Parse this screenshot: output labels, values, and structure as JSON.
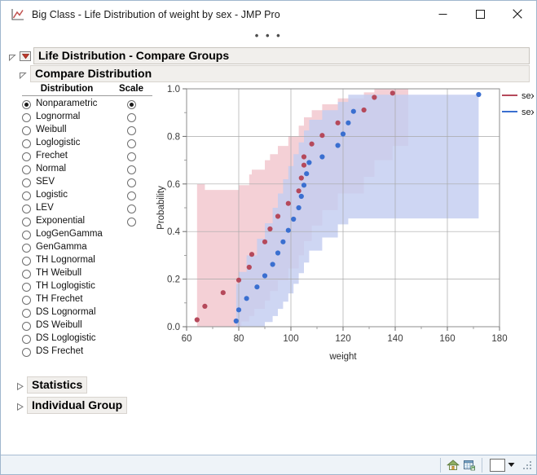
{
  "window": {
    "title": "Big Class - Life Distribution of weight by sex - JMP Pro",
    "app_icon": "jmp-chart-icon",
    "overflow_dots": "• • •",
    "controls": {
      "minimize": "minimize-icon",
      "maximize": "maximize-icon",
      "close": "close-icon"
    }
  },
  "outline": {
    "root": {
      "label": "Life Distribution - Compare Groups",
      "menu_icon": "red-triangle-menu-icon",
      "disclosure_icon": "disclosure-open-icon"
    },
    "compare_distribution": {
      "label": "Compare Distribution",
      "disclosure_icon": "disclosure-open-icon"
    },
    "statistics": {
      "label": "Statistics",
      "disclosure_icon": "disclosure-closed-icon"
    },
    "individual_group": {
      "label": "Individual Group",
      "disclosure_icon": "disclosure-closed-icon"
    }
  },
  "distribution_panel": {
    "headers": {
      "distribution": "Distribution",
      "scale": "Scale"
    },
    "selected_distribution": "Nonparametric",
    "selected_scale": "Nonparametric",
    "items": [
      {
        "label": "Nonparametric",
        "distribution_selected": true,
        "scale_selected": true,
        "has_scale": true
      },
      {
        "label": "Lognormal",
        "distribution_selected": false,
        "scale_selected": false,
        "has_scale": true
      },
      {
        "label": "Weibull",
        "distribution_selected": false,
        "scale_selected": false,
        "has_scale": true
      },
      {
        "label": "Loglogistic",
        "distribution_selected": false,
        "scale_selected": false,
        "has_scale": true
      },
      {
        "label": "Frechet",
        "distribution_selected": false,
        "scale_selected": false,
        "has_scale": true
      },
      {
        "label": "Normal",
        "distribution_selected": false,
        "scale_selected": false,
        "has_scale": true
      },
      {
        "label": "SEV",
        "distribution_selected": false,
        "scale_selected": false,
        "has_scale": true
      },
      {
        "label": "Logistic",
        "distribution_selected": false,
        "scale_selected": false,
        "has_scale": true
      },
      {
        "label": "LEV",
        "distribution_selected": false,
        "scale_selected": false,
        "has_scale": true
      },
      {
        "label": "Exponential",
        "distribution_selected": false,
        "scale_selected": false,
        "has_scale": true
      },
      {
        "label": "LogGenGamma",
        "distribution_selected": false,
        "scale_selected": false,
        "has_scale": false
      },
      {
        "label": "GenGamma",
        "distribution_selected": false,
        "scale_selected": false,
        "has_scale": false
      },
      {
        "label": "TH Lognormal",
        "distribution_selected": false,
        "scale_selected": false,
        "has_scale": false
      },
      {
        "label": "TH Weibull",
        "distribution_selected": false,
        "scale_selected": false,
        "has_scale": false
      },
      {
        "label": "TH Loglogistic",
        "distribution_selected": false,
        "scale_selected": false,
        "has_scale": false
      },
      {
        "label": "TH Frechet",
        "distribution_selected": false,
        "scale_selected": false,
        "has_scale": false
      },
      {
        "label": "DS Lognormal",
        "distribution_selected": false,
        "scale_selected": false,
        "has_scale": false
      },
      {
        "label": "DS Weibull",
        "distribution_selected": false,
        "scale_selected": false,
        "has_scale": false
      },
      {
        "label": "DS Loglogistic",
        "distribution_selected": false,
        "scale_selected": false,
        "has_scale": false
      },
      {
        "label": "DS Frechet",
        "distribution_selected": false,
        "scale_selected": false,
        "has_scale": false
      }
    ]
  },
  "statusbar": {
    "home_icon": "home-icon",
    "datatable_icon": "data-table-icon",
    "color_swatch": "#ffffff",
    "caret_icon": "chevron-down-icon",
    "resize_grip_icon": "resize-grip-icon"
  },
  "chart_data": {
    "type": "scatter",
    "title": "",
    "xlabel": "weight",
    "ylabel": "Probability",
    "xlim": [
      60,
      180
    ],
    "ylim": [
      0.0,
      1.0
    ],
    "xticks": [
      60,
      80,
      100,
      120,
      140,
      160,
      180
    ],
    "yticks": [
      0.0,
      0.2,
      0.4,
      0.6,
      0.8,
      1.0
    ],
    "xtick_labels": [
      "60",
      "80",
      "100",
      "120",
      "140",
      "160",
      "180"
    ],
    "ytick_labels": [
      "0.0",
      "0.2",
      "0.4",
      "0.6",
      "0.8",
      "1.0"
    ],
    "grid": true,
    "legend_position": "right",
    "colors": {
      "F": "#b5495b",
      "M": "#3a6fd0",
      "band_F": "#f2c6cd",
      "band_M": "#c3cdf0"
    },
    "legend": [
      {
        "label": "sex=F",
        "color": "#b5495b",
        "marker": "line"
      },
      {
        "label": "sex=M",
        "color": "#3a6fd0",
        "marker": "line"
      }
    ],
    "series": [
      {
        "name": "sex=F",
        "color": "#b5495b",
        "points": [
          [
            64,
            0.029
          ],
          [
            67,
            0.086
          ],
          [
            74,
            0.143
          ],
          [
            80,
            0.196
          ],
          [
            84,
            0.25
          ],
          [
            85,
            0.304
          ],
          [
            90,
            0.357
          ],
          [
            92,
            0.411
          ],
          [
            95,
            0.464
          ],
          [
            99,
            0.518
          ],
          [
            103,
            0.571
          ],
          [
            104,
            0.625
          ],
          [
            105,
            0.679
          ],
          [
            105,
            0.714
          ],
          [
            108,
            0.768
          ],
          [
            112,
            0.804
          ],
          [
            118,
            0.857
          ],
          [
            128,
            0.911
          ],
          [
            132,
            0.964
          ],
          [
            139,
            0.982
          ]
        ]
      },
      {
        "name": "sex=M",
        "color": "#3a6fd0",
        "points": [
          [
            79,
            0.024
          ],
          [
            80,
            0.071
          ],
          [
            83,
            0.119
          ],
          [
            87,
            0.167
          ],
          [
            90,
            0.214
          ],
          [
            93,
            0.262
          ],
          [
            95,
            0.31
          ],
          [
            97,
            0.357
          ],
          [
            99,
            0.405
          ],
          [
            101,
            0.452
          ],
          [
            103,
            0.5
          ],
          [
            104,
            0.548
          ],
          [
            105,
            0.595
          ],
          [
            106,
            0.643
          ],
          [
            107,
            0.69
          ],
          [
            112,
            0.714
          ],
          [
            118,
            0.762
          ],
          [
            120,
            0.81
          ],
          [
            122,
            0.857
          ],
          [
            124,
            0.905
          ],
          [
            172,
            0.976
          ]
        ]
      }
    ],
    "confidence_bands": [
      {
        "name": "sex=F",
        "fill": "#f2c6cd",
        "lower": [
          [
            64,
            0.0
          ],
          [
            80,
            0.0
          ],
          [
            81,
            0.022
          ],
          [
            84,
            0.045
          ],
          [
            86,
            0.075
          ],
          [
            90,
            0.11
          ],
          [
            92,
            0.15
          ],
          [
            95,
            0.195
          ],
          [
            99,
            0.245
          ],
          [
            103,
            0.3
          ],
          [
            105,
            0.36
          ],
          [
            108,
            0.425
          ],
          [
            112,
            0.49
          ],
          [
            118,
            0.56
          ],
          [
            128,
            0.63
          ],
          [
            132,
            0.7
          ],
          [
            139,
            0.76
          ],
          [
            145,
            0.4
          ],
          [
            145,
            0.0
          ]
        ],
        "upper": [
          [
            64,
            0.6
          ],
          [
            67,
            0.575
          ],
          [
            74,
            0.575
          ],
          [
            80,
            0.595
          ],
          [
            84,
            0.64
          ],
          [
            85,
            0.66
          ],
          [
            90,
            0.7
          ],
          [
            92,
            0.725
          ],
          [
            95,
            0.76
          ],
          [
            99,
            0.8
          ],
          [
            103,
            0.845
          ],
          [
            105,
            0.88
          ],
          [
            108,
            0.91
          ],
          [
            112,
            0.935
          ],
          [
            118,
            0.96
          ],
          [
            128,
            0.985
          ],
          [
            132,
            1.0
          ],
          [
            139,
            1.0
          ],
          [
            145,
            1.0
          ]
        ]
      },
      {
        "name": "sex=M",
        "fill": "#c3cdf0",
        "lower": [
          [
            79,
            0.0
          ],
          [
            87,
            0.0
          ],
          [
            90,
            0.02
          ],
          [
            93,
            0.045
          ],
          [
            95,
            0.075
          ],
          [
            97,
            0.105
          ],
          [
            99,
            0.14
          ],
          [
            101,
            0.18
          ],
          [
            103,
            0.225
          ],
          [
            105,
            0.27
          ],
          [
            107,
            0.32
          ],
          [
            112,
            0.375
          ],
          [
            118,
            0.43
          ],
          [
            122,
            0.455
          ],
          [
            172,
            0.455
          ],
          [
            172,
            0.0
          ]
        ],
        "upper": [
          [
            79,
            0.18
          ],
          [
            80,
            0.23
          ],
          [
            83,
            0.3
          ],
          [
            87,
            0.37
          ],
          [
            90,
            0.435
          ],
          [
            93,
            0.5
          ],
          [
            95,
            0.56
          ],
          [
            97,
            0.62
          ],
          [
            99,
            0.675
          ],
          [
            101,
            0.725
          ],
          [
            103,
            0.775
          ],
          [
            105,
            0.825
          ],
          [
            107,
            0.87
          ],
          [
            112,
            0.91
          ],
          [
            118,
            0.945
          ],
          [
            122,
            0.975
          ],
          [
            172,
            1.0
          ]
        ]
      }
    ]
  }
}
